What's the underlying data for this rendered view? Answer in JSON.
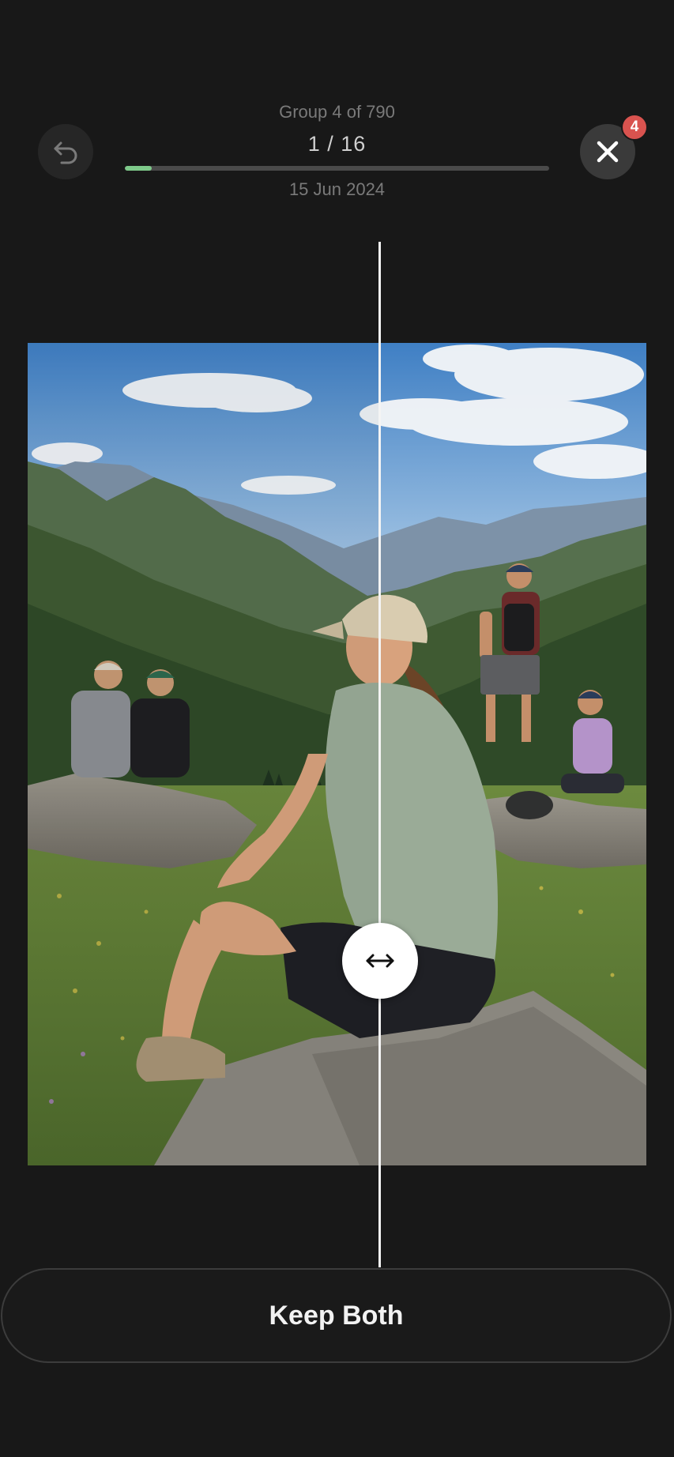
{
  "header": {
    "group_label": "Group 4 of 790",
    "counter": "1 / 16",
    "date": "15 Jun 2024",
    "progress": 0.0625,
    "progress_color": "#7ec98a"
  },
  "undo_button": {
    "icon": "undo-icon"
  },
  "close_button": {
    "icon": "close-icon",
    "badge": "4",
    "badge_color": "#d9534f"
  },
  "comparison": {
    "left_photo": "hikers-resting-on-rocks",
    "right_photo": "woman-in-cap-viewing-mountains",
    "handle_icon": "left-right-arrow-icon"
  },
  "actions": {
    "keep_both_label": "Keep Both"
  }
}
